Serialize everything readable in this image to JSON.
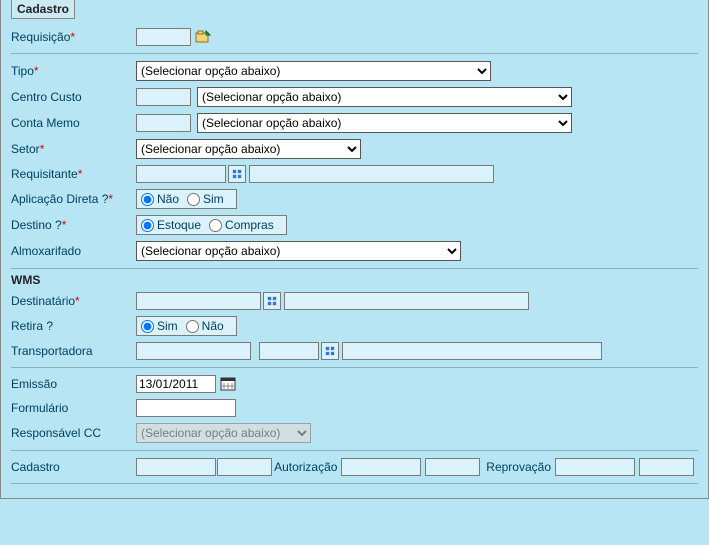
{
  "header": {
    "tab": "Cadastro"
  },
  "labels": {
    "requisicao": "Requisição",
    "tipo": "Tipo",
    "centro_custo": "Centro Custo",
    "conta_memo": "Conta Memo",
    "setor": "Setor",
    "requisitante": "Requisitante",
    "aplic_direta": "Aplicação Direta ?",
    "destino": "Destino ?",
    "almox": "Almoxarifado",
    "wms": "WMS",
    "destinatario": "Destinatário",
    "retira": "Retira ?",
    "transportadora": "Transportadora",
    "emissao": "Emissão",
    "formulario": "Formulário",
    "responsavel_cc": "Responsável CC",
    "cadastro": "Cadastro",
    "autorizacao": "Autorização",
    "reprovacao": "Reprovação",
    "star": "*"
  },
  "placeholders": {
    "select_default": "(Selecionar opção abaixo)"
  },
  "radios": {
    "nao": "Não",
    "sim": "Sim",
    "estoque": "Estoque",
    "compras": "Compras"
  },
  "values": {
    "emissao": "13/01/2011"
  }
}
